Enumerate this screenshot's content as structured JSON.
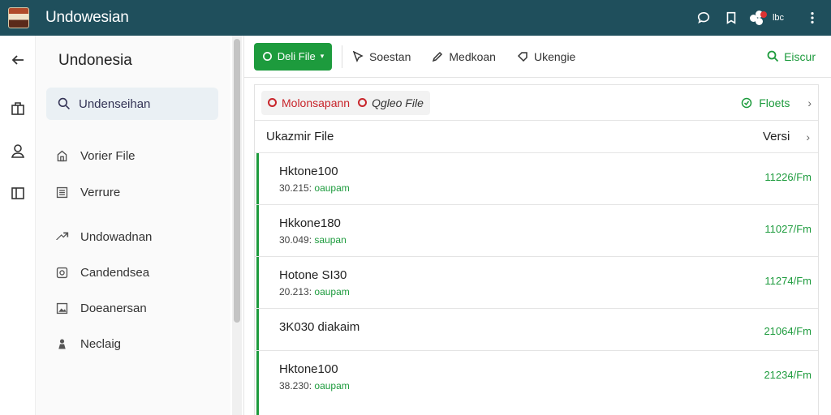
{
  "app": {
    "title": "Undowesian"
  },
  "topbar": {
    "user_label": "lbc"
  },
  "sidebar": {
    "title": "Undonesia",
    "search_label": "Undenseihan",
    "items": [
      {
        "label": "Vorier File",
        "icon": "file-icon"
      },
      {
        "label": "Verrure",
        "icon": "list-icon"
      },
      {
        "label": "Undowadnan",
        "icon": "arrow-icon"
      },
      {
        "label": "Candendsea",
        "icon": "gear-icon"
      },
      {
        "label": "Doeanersan",
        "icon": "image-icon"
      },
      {
        "label": "Neclaig",
        "icon": "person-icon"
      }
    ]
  },
  "toolbar": {
    "primary_label": "Deli File",
    "buttons": [
      {
        "label": "Soestan",
        "icon": "cursor-icon"
      },
      {
        "label": "Medkoan",
        "icon": "pencil-icon"
      },
      {
        "label": "Ukengie",
        "icon": "tag-icon"
      }
    ],
    "search_label": "Eiscur"
  },
  "breadcrumb": {
    "first": "Molonsapann",
    "second": "Qgleo File",
    "right_label": "Floets"
  },
  "table": {
    "header_left": "Ukazmir File",
    "header_right": "Versi",
    "rows": [
      {
        "name": "Hktone100",
        "sub_num": "30.215:",
        "sub_tag": "oaupam",
        "value": "11226/Fm"
      },
      {
        "name": "Hkkone180",
        "sub_num": "30.049:",
        "sub_tag": "saupan",
        "value": "11027/Fm"
      },
      {
        "name": "Hotone SI30",
        "sub_num": "20.213:",
        "sub_tag": "oaupam",
        "value": "11274/Fm"
      },
      {
        "name": "3K030 diakaim",
        "sub_num": "",
        "sub_tag": "",
        "value": "21064/Fm"
      },
      {
        "name": "Hktone100",
        "sub_num": "38.230:",
        "sub_tag": "oaupam",
        "value": "21234/Fm"
      }
    ]
  },
  "colors": {
    "topbar": "#1f4f5c",
    "accent": "#1d9b3d",
    "alert": "#c8252b"
  }
}
